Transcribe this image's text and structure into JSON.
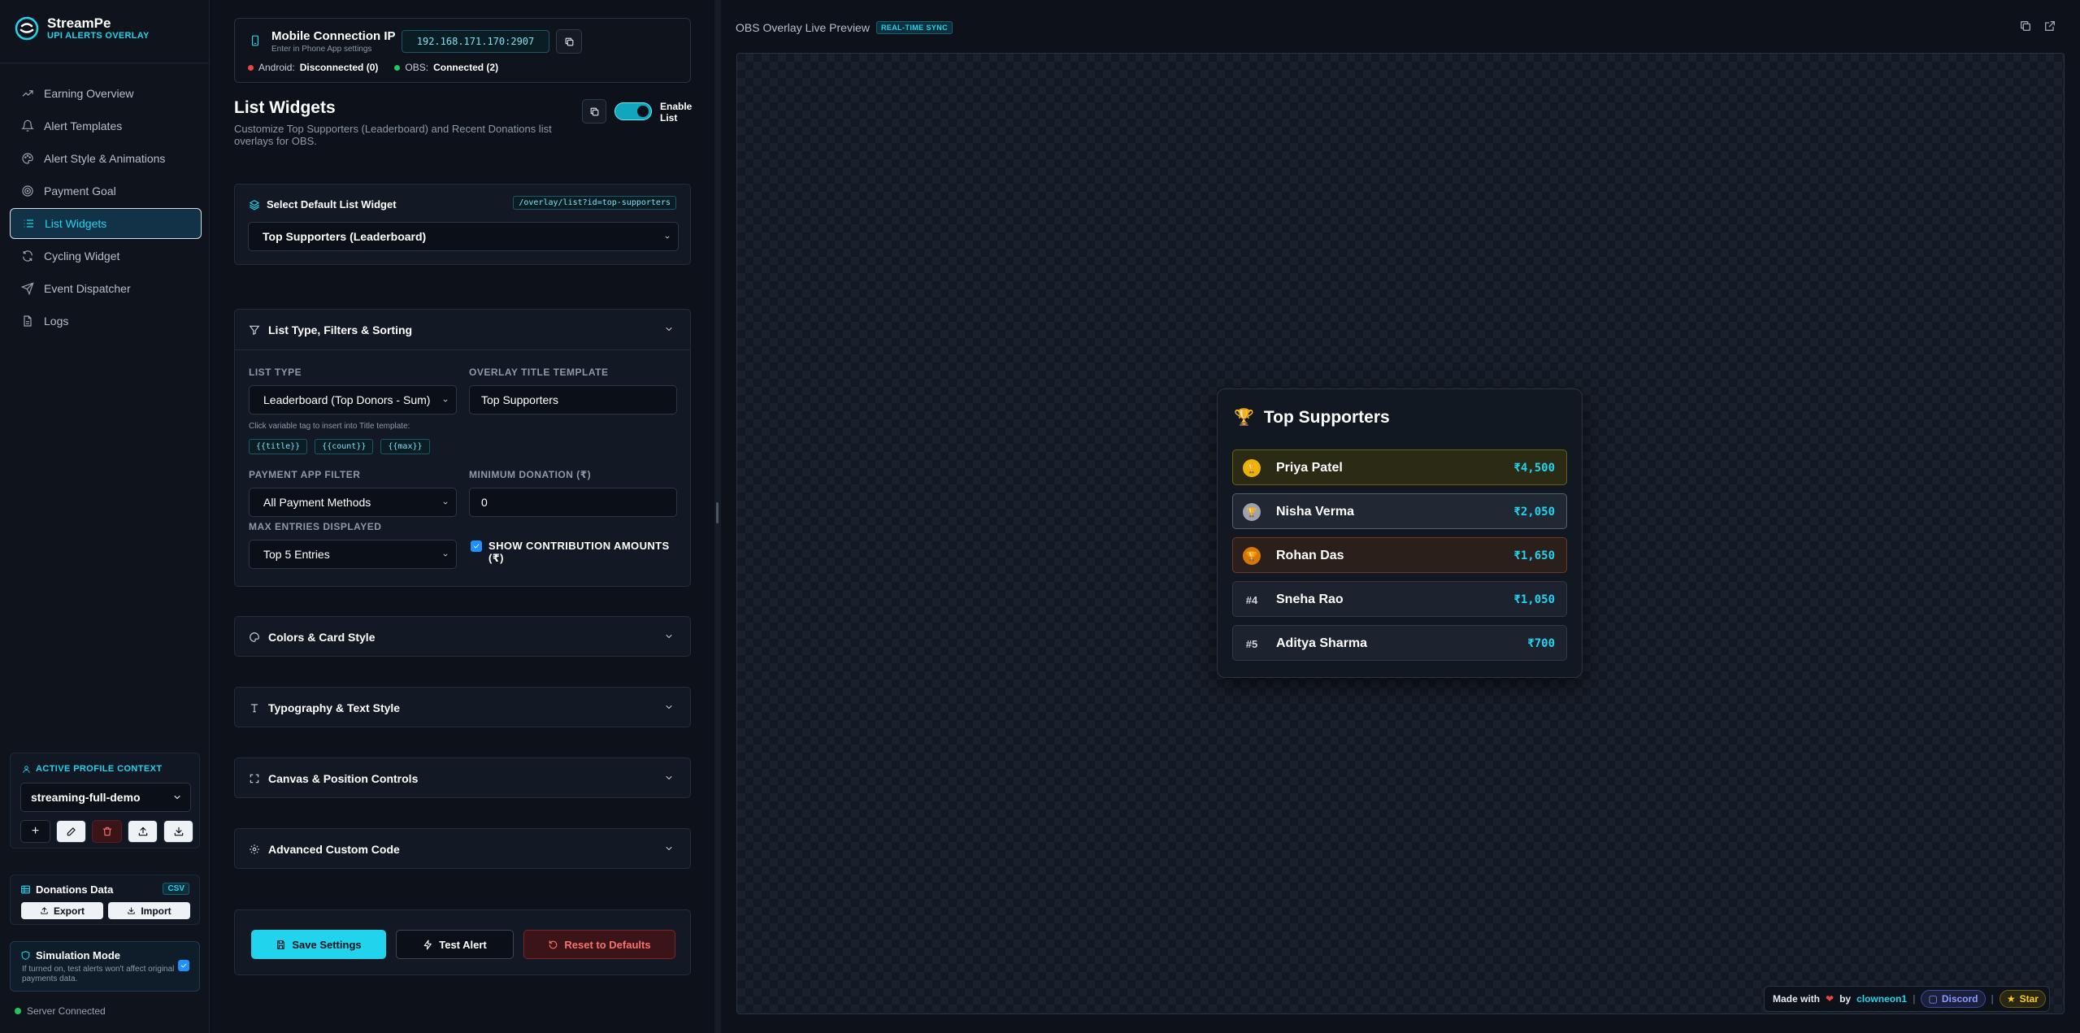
{
  "brand": {
    "name": "StreamPe",
    "tagline": "UPI ALERTS OVERLAY"
  },
  "sidebar": {
    "items": [
      {
        "label": "Earning Overview",
        "icon": "trending-up-icon"
      },
      {
        "label": "Alert Templates",
        "icon": "bell-icon"
      },
      {
        "label": "Alert Style & Animations",
        "icon": "palette-icon"
      },
      {
        "label": "Payment Goal",
        "icon": "target-icon"
      },
      {
        "label": "List Widgets",
        "icon": "list-icon",
        "active": true
      },
      {
        "label": "Cycling Widget",
        "icon": "refresh-icon"
      },
      {
        "label": "Event Dispatcher",
        "icon": "send-icon"
      },
      {
        "label": "Logs",
        "icon": "document-icon"
      }
    ],
    "profile": {
      "title": "ACTIVE PROFILE CONTEXT",
      "selected": "streaming-full-demo",
      "add_label": "+"
    },
    "donations": {
      "title": "Donations Data",
      "badge": "CSV",
      "export_label": "Export",
      "import_label": "Import"
    },
    "simulation": {
      "title": "Simulation Mode",
      "description": "If turned on, test alerts won't affect original payments data.",
      "checked": true
    },
    "server_status": "Server Connected"
  },
  "connection": {
    "title": "Mobile Connection IP",
    "subtitle": "Enter in Phone App settings",
    "ip": "192.168.171.170:2907",
    "android_label": "Android:",
    "android_status": "Disconnected (0)",
    "obs_label": "OBS:",
    "obs_status": "Connected (2)"
  },
  "page": {
    "title": "List Widgets",
    "description": "Customize Top Supporters (Leaderboard) and Recent Donations list overlays for OBS.",
    "toggle_label_1": "Enable",
    "toggle_label_2": "List",
    "enabled": true
  },
  "default_widget": {
    "title": "Select Default List Widget",
    "path": "/overlay/list?id=top-supporters",
    "selected": "Top Supporters (Leaderboard)"
  },
  "filters": {
    "title": "List Type, Filters & Sorting",
    "list_type_label": "LIST TYPE",
    "list_type_value": "Leaderboard (Top Donors - Sum)",
    "title_template_label": "OVERLAY TITLE TEMPLATE",
    "title_template_value": "Top Supporters",
    "var_hint": "Click variable tag to insert into Title template:",
    "var_tags": [
      "{{title}}",
      "{{count}}",
      "{{max}}"
    ],
    "payment_filter_label": "PAYMENT APP FILTER",
    "payment_filter_value": "All Payment Methods",
    "min_donation_label": "MINIMUM DONATION (₹)",
    "min_donation_value": "0",
    "max_entries_label": "MAX ENTRIES DISPLAYED",
    "max_entries_value": "Top 5 Entries",
    "show_amounts_label": "SHOW CONTRIBUTION AMOUNTS (₹)",
    "show_amounts_checked": true
  },
  "sections": {
    "colors": "Colors & Card Style",
    "typography": "Typography & Text Style",
    "canvas": "Canvas & Position Controls",
    "advanced": "Advanced Custom Code"
  },
  "actions": {
    "save": "Save Settings",
    "test": "Test Alert",
    "reset": "Reset to Defaults"
  },
  "preview": {
    "title": "OBS Overlay Live Preview",
    "badge": "REAL-TIME SYNC",
    "leaderboard": {
      "title": "Top Supporters",
      "entries": [
        {
          "rank": "🏆",
          "name": "Priya Patel",
          "amount": "₹4,500"
        },
        {
          "rank": "🏆",
          "name": "Nisha Verma",
          "amount": "₹2,050"
        },
        {
          "rank": "🏆",
          "name": "Rohan Das",
          "amount": "₹1,650"
        },
        {
          "rank": "#4",
          "name": "Sneha Rao",
          "amount": "₹1,050"
        },
        {
          "rank": "#5",
          "name": "Aditya Sharma",
          "amount": "₹700"
        }
      ]
    },
    "footer": {
      "made_with": "Made with",
      "by": "by",
      "author": "clowneon1",
      "discord": "Discord",
      "star": "Star"
    }
  },
  "colors": {
    "accent": "#22d3ee",
    "background": "#0b0f17",
    "danger": "#f87171",
    "success": "#22c55e",
    "error": "#ef4444"
  }
}
